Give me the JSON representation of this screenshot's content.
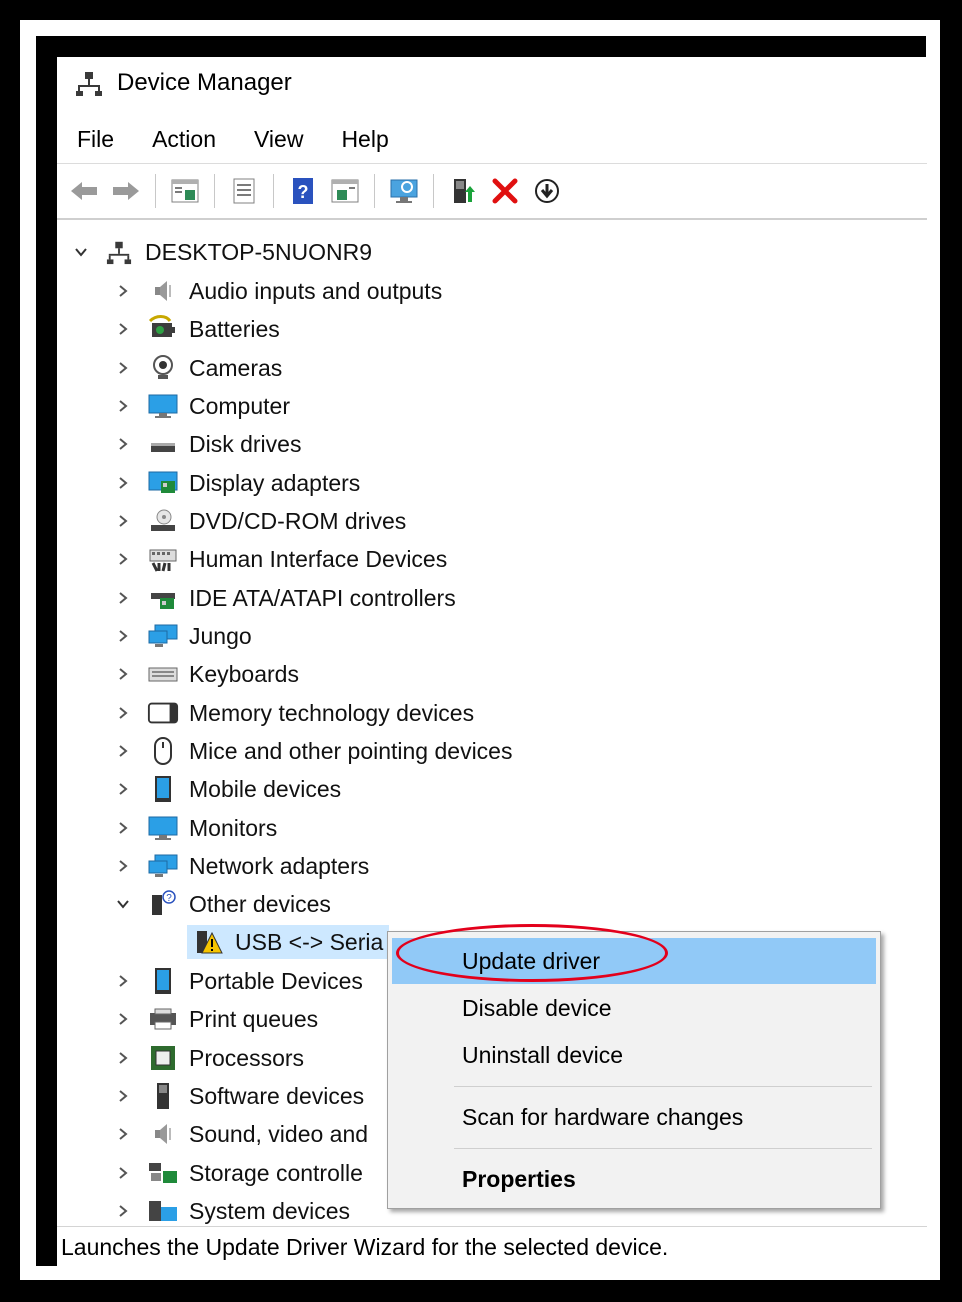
{
  "window": {
    "title": "Device Manager"
  },
  "menu": [
    "File",
    "Action",
    "View",
    "Help"
  ],
  "toolbar": {
    "buttons": [
      "back-icon",
      "forward-icon",
      "show-hide-console-tree-icon",
      "properties-icon",
      "help-icon",
      "action-pane-icon",
      "scan-hardware-icon",
      "update-driver-icon",
      "uninstall-icon",
      "install-icon"
    ]
  },
  "tree": {
    "root": "DESKTOP-5NUONR9",
    "categories": [
      "Audio inputs and outputs",
      "Batteries",
      "Cameras",
      "Computer",
      "Disk drives",
      "Display adapters",
      "DVD/CD-ROM drives",
      "Human Interface Devices",
      "IDE ATA/ATAPI controllers",
      "Jungo",
      "Keyboards",
      "Memory technology devices",
      "Mice and other pointing devices",
      "Mobile devices",
      "Monitors",
      "Network adapters",
      "Other devices",
      "Portable Devices",
      "Print queues",
      "Processors",
      "Software devices",
      "Sound, video and",
      "Storage controlle",
      "System devices"
    ],
    "child": "USB <-> Seria"
  },
  "context_menu": {
    "items": [
      "Update driver",
      "Disable device",
      "Uninstall device",
      "Scan for hardware changes",
      "Properties"
    ]
  },
  "status": {
    "text": "Launches the Update Driver Wizard for the selected device."
  },
  "colors": {
    "highlight": "#91c9f7",
    "annotation": "#e3001b",
    "selection": "#cde8ff"
  }
}
